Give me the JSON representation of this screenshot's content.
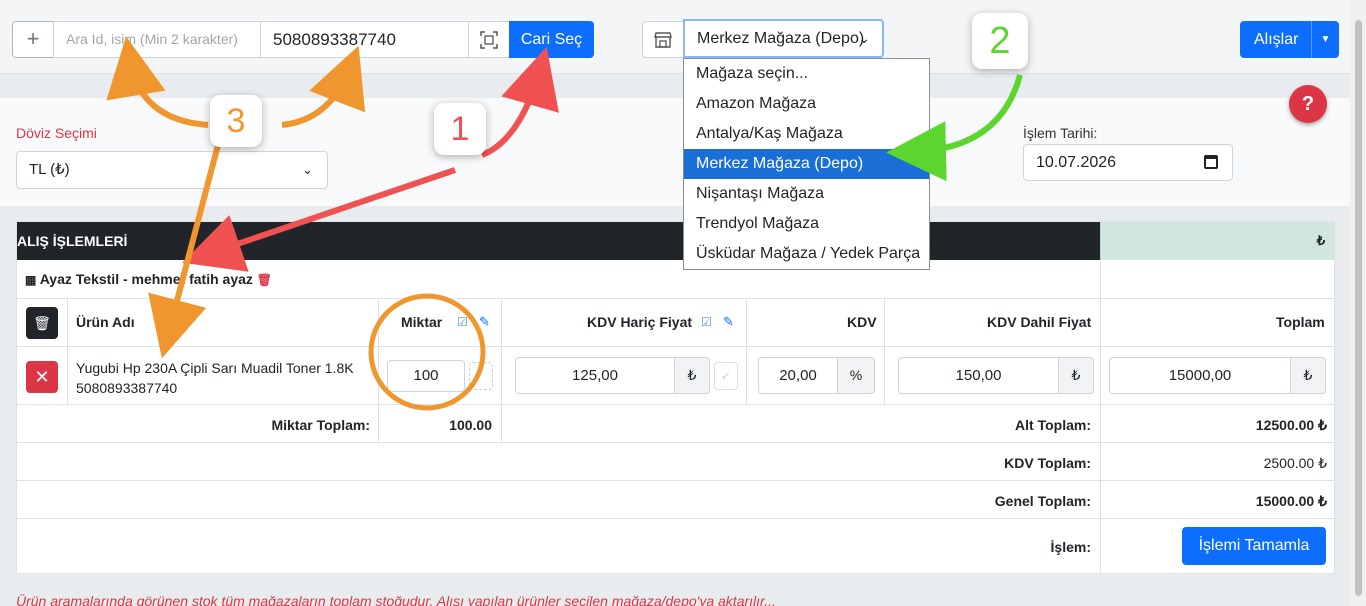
{
  "topbar": {
    "add_label": "+",
    "search_placeholder": "Ara Id, isim (Min 2 karakter)",
    "barcode_value": "5080893387740",
    "cari_button": "Cari Seç",
    "store_selected": "Merkez Mağaza (Depo)",
    "alislar_button": "Alışlar"
  },
  "store_dropdown": {
    "options": [
      "Mağaza seçin...",
      "Amazon Mağaza",
      "Antalya/Kaş Mağaza",
      "Merkez Mağaza (Depo)",
      "Nişantaşı Mağaza",
      "Trendyol Mağaza",
      "Üsküdar Mağaza / Yedek Parça"
    ],
    "selected_index": 3
  },
  "form": {
    "doviz_label": "Döviz Seçimi",
    "doviz_value": "TL (₺)",
    "date_label": "İşlem Tarihi:",
    "date_value": "10.07.2026",
    "help": "?"
  },
  "table": {
    "title": "ALIŞ İŞLEMLERİ",
    "currency_header": "₺",
    "supplier": "Ayaz Tekstil - mehmet fatih ayaz",
    "columns": {
      "product": "Ürün Adı",
      "quantity": "Miktar",
      "price_excl": "KDV Hariç Fiyat",
      "vat": "KDV",
      "price_incl": "KDV Dahil Fiyat",
      "total": "Toplam"
    },
    "row": {
      "name": "Yugubi Hp 230A Çipli Sarı Muadil Toner 1.8K",
      "barcode": "5080893387740",
      "quantity": "100",
      "price_excl": "125,00",
      "vat": "20,00",
      "price_incl": "150,00",
      "total": "15000,00",
      "currency": "₺",
      "percent": "%"
    },
    "summary": {
      "qty_total_label": "Miktar Toplam:",
      "qty_total": "100.00",
      "subtotal_label": "Alt Toplam:",
      "subtotal": "12500.00 ₺",
      "vat_total_label": "KDV Toplam:",
      "vat_total": "2500.00 ₺",
      "grand_total_label": "Genel Toplam:",
      "grand_total": "15000.00 ₺",
      "action_label": "İşlem:",
      "complete_button": "İşlemi Tamamla"
    }
  },
  "footnote": "Ürün aramalarında görünen stok tüm mağazaların toplam stoğudur. Alışı yapılan ürünler seçilen mağaza/depo'ya aktarılır...",
  "annotations": [
    "1",
    "2",
    "3"
  ],
  "colors": {
    "primary": "#0d6efd",
    "danger": "#dc3545",
    "dark": "#212529",
    "success_light": "#d1e7dd",
    "annot_red": "#f05252",
    "annot_green": "#5cd62e",
    "annot_orange": "#f0962e"
  }
}
